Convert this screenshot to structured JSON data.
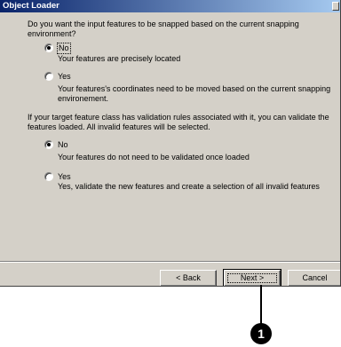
{
  "window": {
    "title": "Object Loader"
  },
  "snapping": {
    "question": "Do you want the input features to be snapped based on the current snapping environment?",
    "option_no": {
      "label": "No",
      "selected": true,
      "description": "Your features are precisely located"
    },
    "option_yes": {
      "label": "Yes",
      "selected": false,
      "description": "Your features's coordinates need to be moved based on the current snapping environement."
    }
  },
  "validation": {
    "question": "If your target feature class has validation rules associated with it, you can validate the features loaded. All invalid features will be selected.",
    "option_no": {
      "label": "No",
      "selected": true,
      "description": "Your features do not need to be validated once loaded"
    },
    "option_yes": {
      "label": "Yes",
      "selected": false,
      "description": "Yes, validate the new features and create a selection of all invalid features"
    }
  },
  "buttons": {
    "back": "< Back",
    "next": "Next >",
    "cancel": "Cancel"
  },
  "callout": {
    "number": "1"
  }
}
